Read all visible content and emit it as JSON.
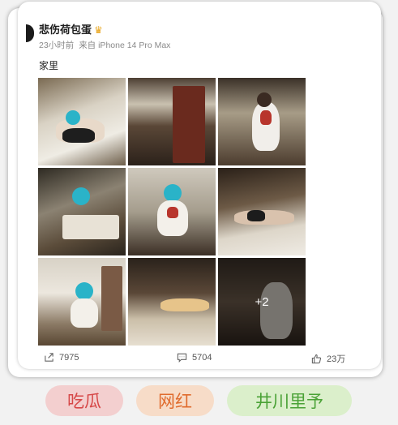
{
  "post": {
    "username": "悲伤荷包蛋",
    "time": "23小时前",
    "source": "来自 iPhone 14 Pro Max",
    "text": "家里",
    "more_count": "+2"
  },
  "actions": {
    "repost_count": "7975",
    "comment_count": "5704",
    "like_count": "23万"
  },
  "tags": [
    "吃瓜",
    "网红",
    "井川里予"
  ],
  "icons": {
    "verified": "crown-icon",
    "repost": "share-icon",
    "comment": "comment-icon",
    "like": "thumbs-up-icon"
  }
}
